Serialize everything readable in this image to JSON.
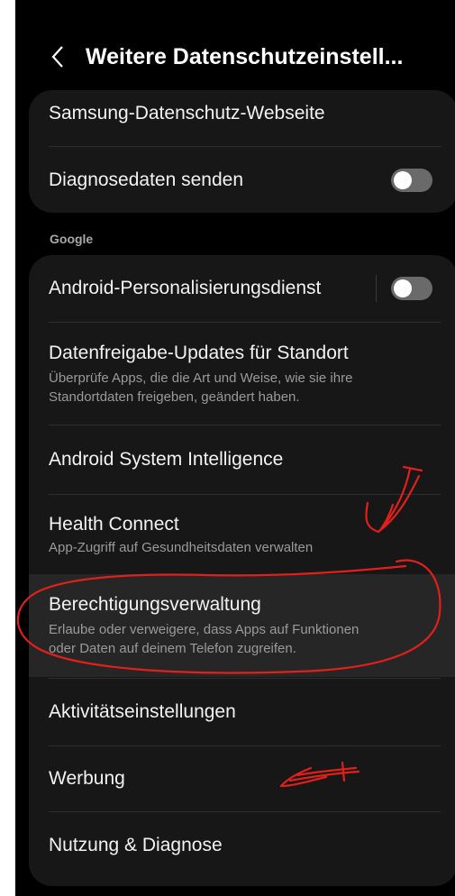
{
  "header": {
    "title": "Weitere Datenschutzeinstell...",
    "back_icon": "chevron-left-icon"
  },
  "group1": {
    "items": [
      {
        "label": "Samsung-Datenschutz-Webseite"
      },
      {
        "label": "Diagnosedaten senden",
        "toggle": "off"
      }
    ]
  },
  "google_section": {
    "header": "Google",
    "items": [
      {
        "label": "Android-Personalisierungsdienst",
        "toggle": "off"
      },
      {
        "label": "Datenfreigabe-Updates für Standort",
        "subtitle_line1": "Überprüfe Apps, die die Art und Weise, wie sie ihre",
        "subtitle_line2": "Standortdaten freigeben, geändert haben."
      },
      {
        "label": "Android System Intelligence"
      },
      {
        "label": "Health Connect",
        "subtitle": "App-Zugriff auf Gesundheitsdaten verwalten"
      },
      {
        "label": "Berechtigungsverwaltung",
        "subtitle_line1": "Erlaube oder verweigere, dass Apps auf Funktionen",
        "subtitle_line2": "oder Daten auf deinem Telefon zugreifen.",
        "highlighted": true
      },
      {
        "label": "Aktivitätseinstellungen"
      },
      {
        "label": "Werbung"
      },
      {
        "label": "Nutzung & Diagnose"
      }
    ]
  },
  "colors": {
    "background": "#000000",
    "card": "#171717",
    "highlight": "#262626",
    "annotation": "#e0201c"
  }
}
